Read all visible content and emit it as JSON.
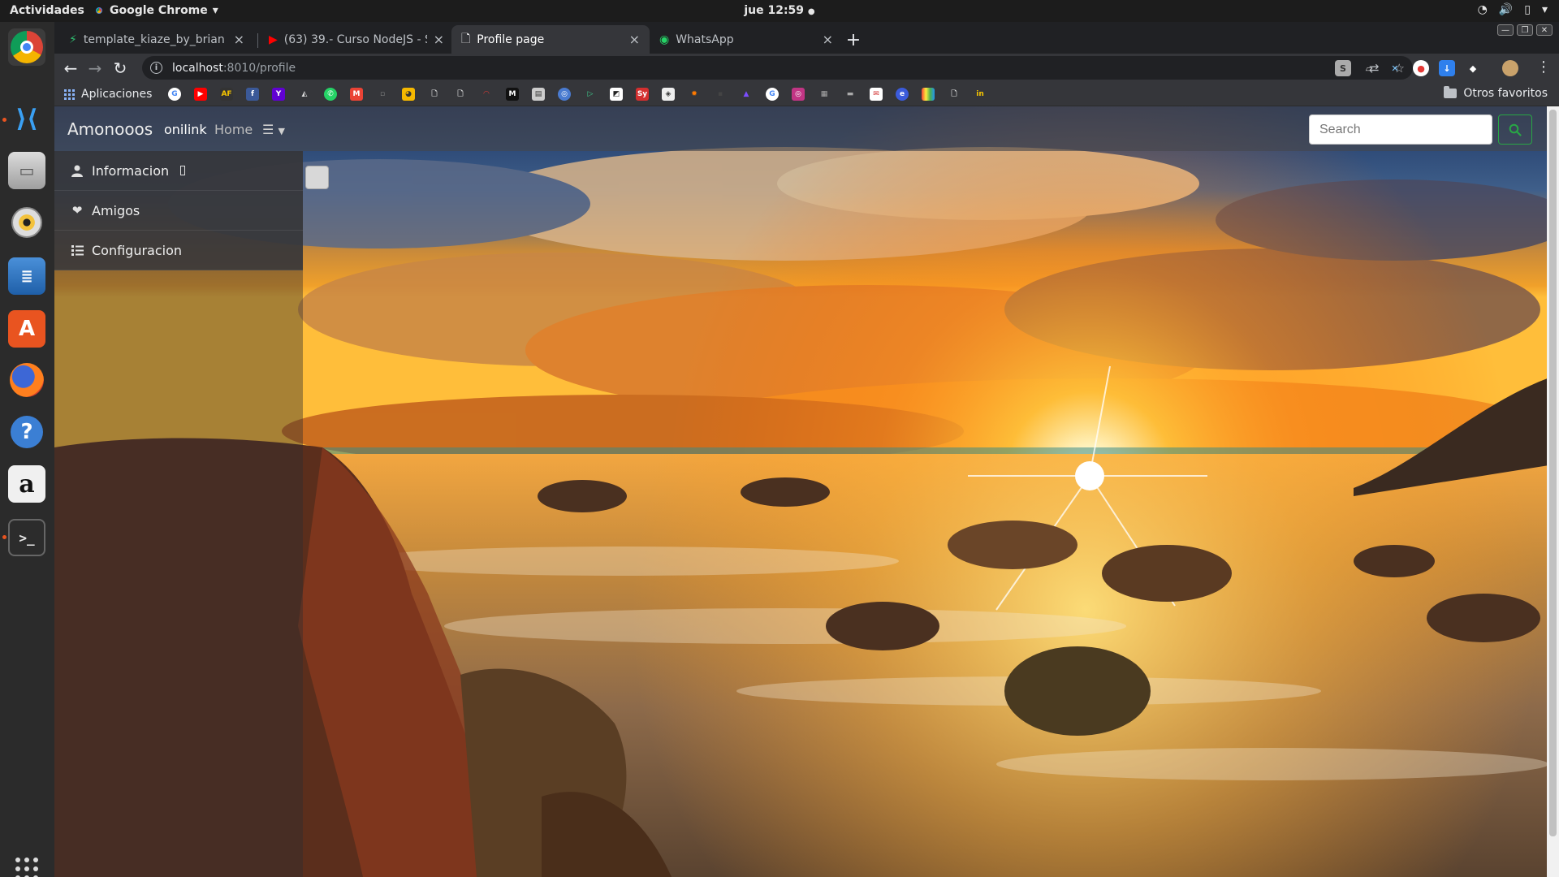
{
  "system": {
    "activities": "Actividades",
    "app_name": "Google Chrome",
    "clock": "jue 12:59"
  },
  "dock": {
    "items": [
      "chrome-icon",
      "vscode-icon",
      "files-icon",
      "rhythmbox-icon",
      "writer-icon",
      "software-store-icon",
      "firefox-icon",
      "help-icon",
      "amazon-icon",
      "terminal-icon",
      "show-apps-icon"
    ]
  },
  "browser": {
    "tabs": [
      {
        "label": "template_kiaze_by_brian",
        "icon": "git-icon",
        "active": false
      },
      {
        "label": "(63) 39.- Curso NodeJS - S",
        "icon": "youtube-icon",
        "active": false
      },
      {
        "label": "Profile page",
        "icon": "page-icon",
        "active": true
      },
      {
        "label": "WhatsApp",
        "icon": "whatsapp-icon",
        "active": false
      }
    ],
    "address": {
      "host": "localhost",
      "path": ":8010/profile"
    },
    "bookmarks": {
      "apps_label": "Aplicaciones",
      "other_label": "Otros favoritos"
    }
  },
  "page": {
    "brand": "Amonooos",
    "nav": {
      "link1": "onilink",
      "link2": "Home"
    },
    "search": {
      "placeholder": "Search"
    },
    "sidebar": {
      "items": [
        {
          "label": "Informacion",
          "icon": "user-icon"
        },
        {
          "label": "Amigos",
          "icon": "heart-icon"
        },
        {
          "label": "Configuracion",
          "icon": "list-icon"
        }
      ]
    },
    "background": "sunset-over-rocky-beach"
  },
  "colors": {
    "search_button": "#28a745",
    "active_tab": "#35363a"
  }
}
